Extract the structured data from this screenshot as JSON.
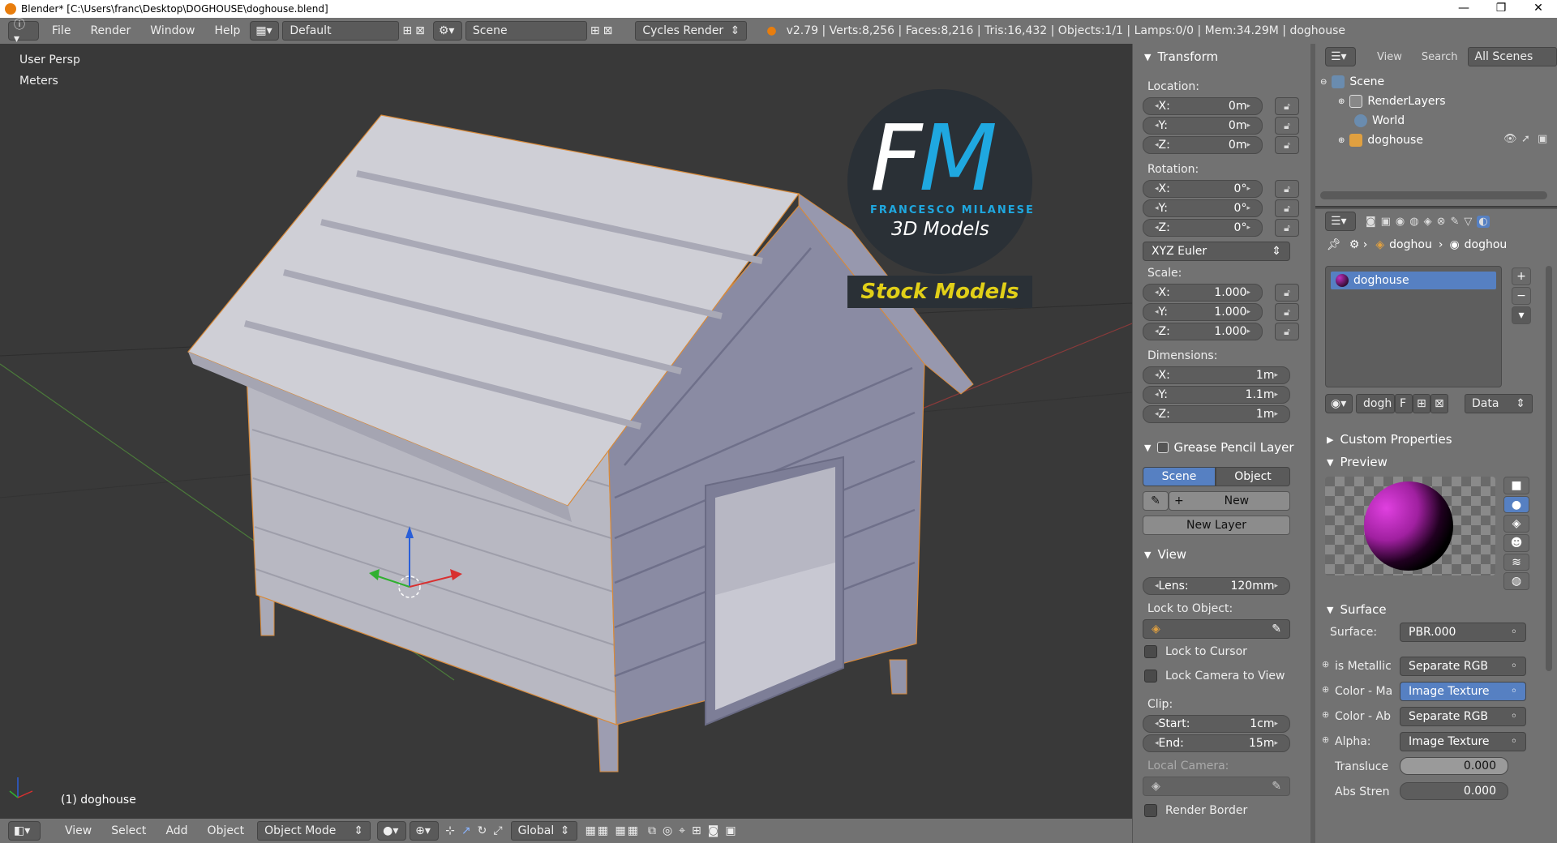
{
  "titlebar": {
    "title": "Blender* [C:\\Users\\franc\\Desktop\\DOGHOUSE\\doghouse.blend]",
    "minimize": "—",
    "maximize": "❐",
    "close": "✕"
  },
  "header": {
    "menus": [
      "File",
      "Render",
      "Window",
      "Help"
    ],
    "layout": "Default",
    "scene": "Scene",
    "engine": "Cycles Render",
    "stats": "v2.79 | Verts:8,256 | Faces:8,216 | Tris:16,432 | Objects:1/1 | Lamps:0/0 | Mem:34.29M | doghouse"
  },
  "viewport": {
    "view_name": "User Persp",
    "units": "Meters",
    "object_label": "(1) doghouse",
    "watermark": {
      "fm_f": "F",
      "fm_m": "M",
      "name": "FRANCESCO MILANESE",
      "models": "3D Models",
      "stock": "Stock Models"
    }
  },
  "footer": {
    "menus": [
      "View",
      "Select",
      "Add",
      "Object"
    ],
    "mode": "Object Mode",
    "orientation": "Global"
  },
  "npanel": {
    "transform_title": "Transform",
    "location_label": "Location:",
    "location": [
      {
        "axis": "X:",
        "value": "0m"
      },
      {
        "axis": "Y:",
        "value": "0m"
      },
      {
        "axis": "Z:",
        "value": "0m"
      }
    ],
    "rotation_label": "Rotation:",
    "rotation": [
      {
        "axis": "X:",
        "value": "0°"
      },
      {
        "axis": "Y:",
        "value": "0°"
      },
      {
        "axis": "Z:",
        "value": "0°"
      }
    ],
    "rotation_mode": "XYZ Euler",
    "scale_label": "Scale:",
    "scale": [
      {
        "axis": "X:",
        "value": "1.000"
      },
      {
        "axis": "Y:",
        "value": "1.000"
      },
      {
        "axis": "Z:",
        "value": "1.000"
      }
    ],
    "dimensions_label": "Dimensions:",
    "dimensions": [
      {
        "axis": "X:",
        "value": "1m"
      },
      {
        "axis": "Y:",
        "value": "1.1m"
      },
      {
        "axis": "Z:",
        "value": "1m"
      }
    ],
    "grease_title": "Grease Pencil Layer",
    "gp_scene": "Scene",
    "gp_object": "Object",
    "gp_new": "New",
    "gp_new_layer": "New Layer",
    "view_title": "View",
    "lens_label": "Lens:",
    "lens_value": "120mm",
    "lock_object_label": "Lock to Object:",
    "lock_cursor": "Lock to Cursor",
    "lock_camera": "Lock Camera to View",
    "clip_label": "Clip:",
    "clip_start_label": "Start:",
    "clip_start": "1cm",
    "clip_end_label": "End:",
    "clip_end": "15m",
    "local_camera_label": "Local Camera:",
    "render_border": "Render Border"
  },
  "outliner": {
    "view": "View",
    "search": "Search",
    "filter": "All Scenes",
    "items": [
      "Scene",
      "RenderLayers",
      "World",
      "doghouse"
    ]
  },
  "properties": {
    "crumb_obj": "doghou",
    "crumb_mat": "doghou",
    "material_slot": "doghouse",
    "material_name": "dogh",
    "fake_user": "F",
    "link": "Data",
    "custom_props": "Custom Properties",
    "preview": "Preview",
    "surface_title": "Surface",
    "surface_label": "Surface:",
    "surface_value": "PBR.000",
    "rows": [
      {
        "label": "is Metallic",
        "value": "Separate RGB"
      },
      {
        "label": "Color - Ma",
        "value": "Image Texture"
      },
      {
        "label": "Color - Ab",
        "value": "Separate RGB"
      },
      {
        "label": "Alpha:",
        "value": "Image Texture"
      }
    ],
    "translucence_label": "Transluce",
    "translucence_value": "0.000",
    "abs_label": "Abs Stren",
    "abs_value": "0.000"
  },
  "colors": {
    "accent": "#5680c2",
    "header": "#727272",
    "viewport": "#393939"
  }
}
